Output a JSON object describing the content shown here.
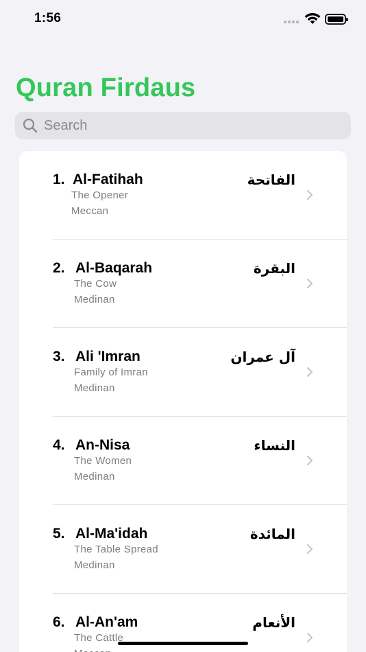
{
  "status_bar": {
    "time": "1:56"
  },
  "header": {
    "title": "Quran Firdaus"
  },
  "search": {
    "placeholder": "Search"
  },
  "colors": {
    "accent": "#34c759",
    "background": "#f2f2f7",
    "secondary_text": "#7c7c80"
  },
  "surahs": [
    {
      "number": "1.",
      "name": "Al-Fatihah",
      "translation": "The Opener",
      "type": "Meccan",
      "arabic": "الفاتحة"
    },
    {
      "number": "2.",
      "name": "Al-Baqarah",
      "translation": "The Cow",
      "type": "Medinan",
      "arabic": "البقرة"
    },
    {
      "number": "3.",
      "name": "Ali 'Imran",
      "translation": "Family of Imran",
      "type": "Medinan",
      "arabic": "آل عمران"
    },
    {
      "number": "4.",
      "name": "An-Nisa",
      "translation": "The Women",
      "type": "Medinan",
      "arabic": "النساء"
    },
    {
      "number": "5.",
      "name": "Al-Ma'idah",
      "translation": "The Table Spread",
      "type": "Medinan",
      "arabic": "المائدة"
    },
    {
      "number": "6.",
      "name": "Al-An'am",
      "translation": "The Cattle",
      "type": "Meccan",
      "arabic": "الأنعام"
    }
  ]
}
